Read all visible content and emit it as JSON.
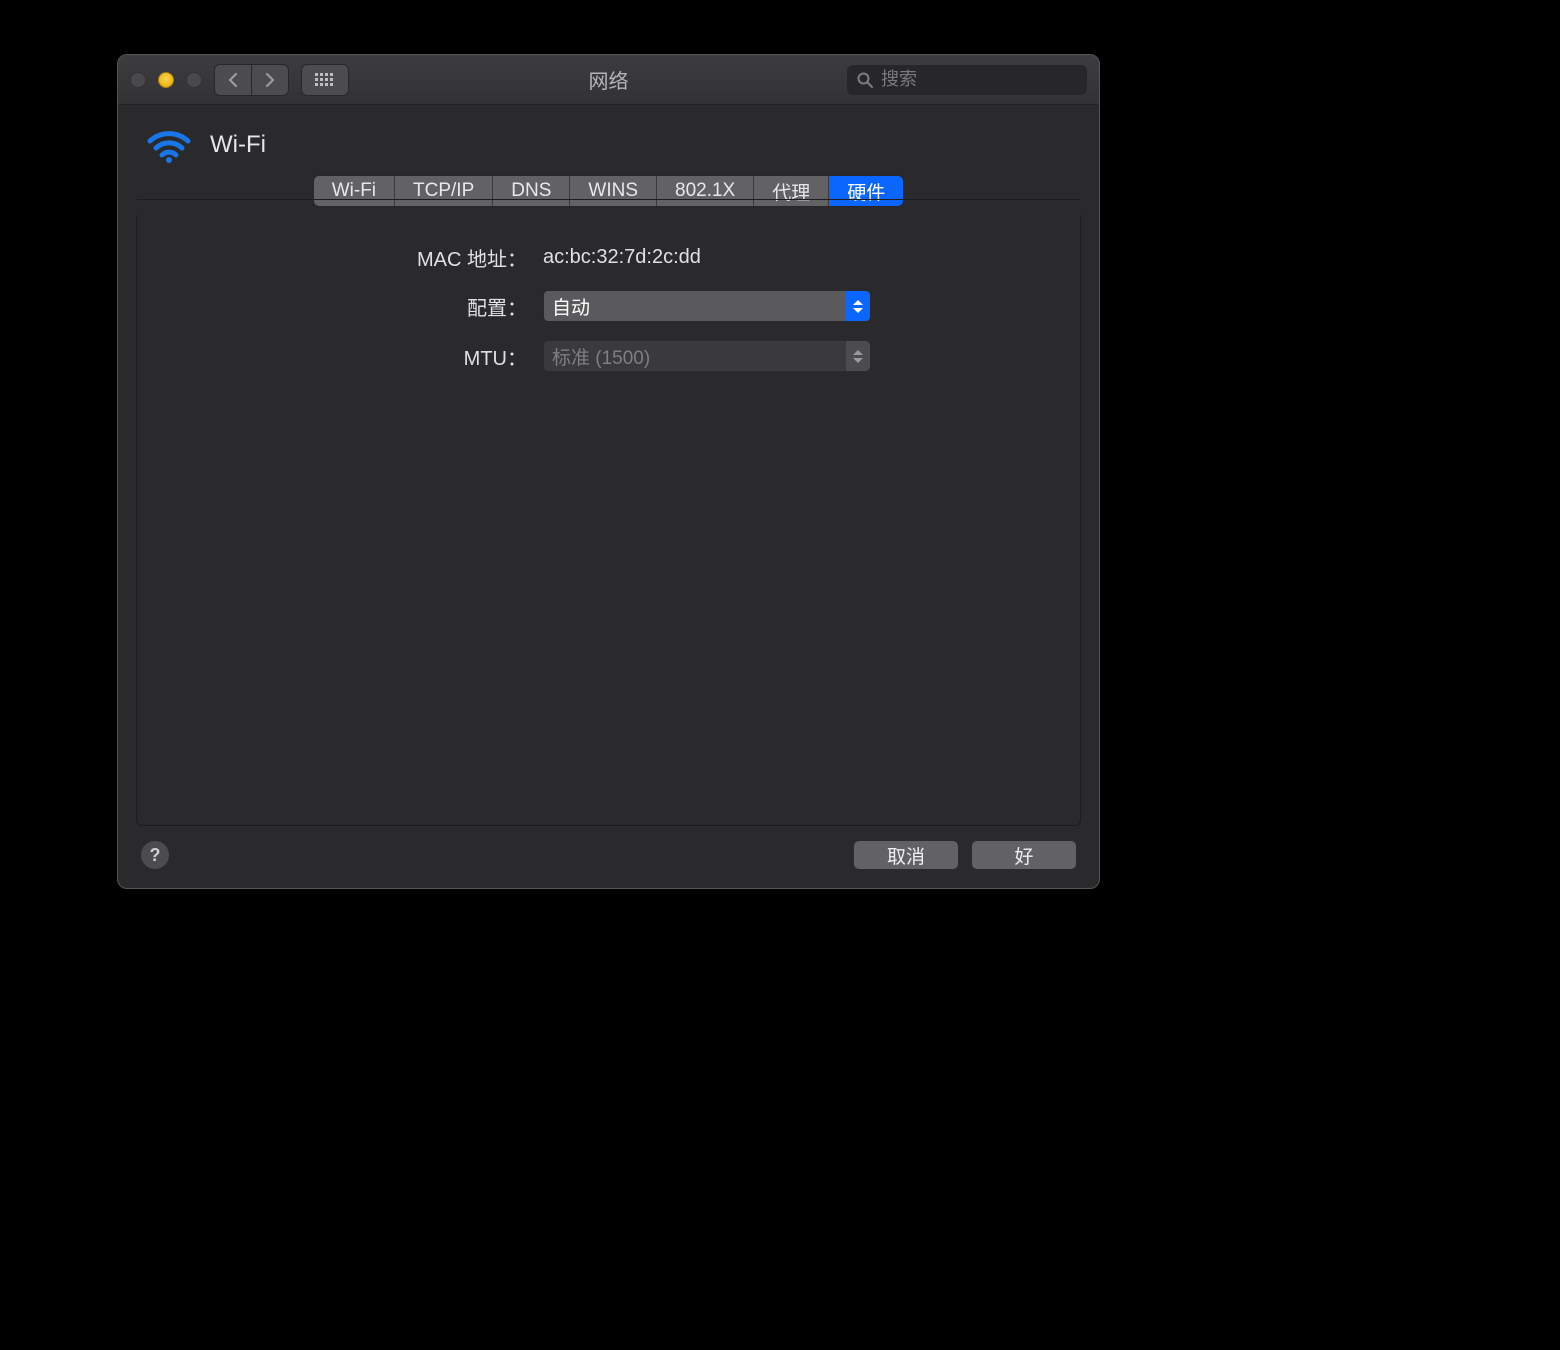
{
  "window": {
    "title": "网络",
    "search_placeholder": "搜索"
  },
  "header": {
    "title": "Wi-Fi"
  },
  "tabs": {
    "items": [
      "Wi-Fi",
      "TCP/IP",
      "DNS",
      "WINS",
      "802.1X",
      "代理",
      "硬件"
    ],
    "selected_index": 6
  },
  "form": {
    "mac_label": "MAC 地址：",
    "mac_value": "ac:bc:32:7d:2c:dd",
    "config_label": "配置：",
    "config_value": "自动",
    "mtu_label": "MTU：",
    "mtu_value": "标准 (1500)"
  },
  "footer": {
    "help_symbol": "?",
    "cancel": "取消",
    "ok": "好"
  }
}
